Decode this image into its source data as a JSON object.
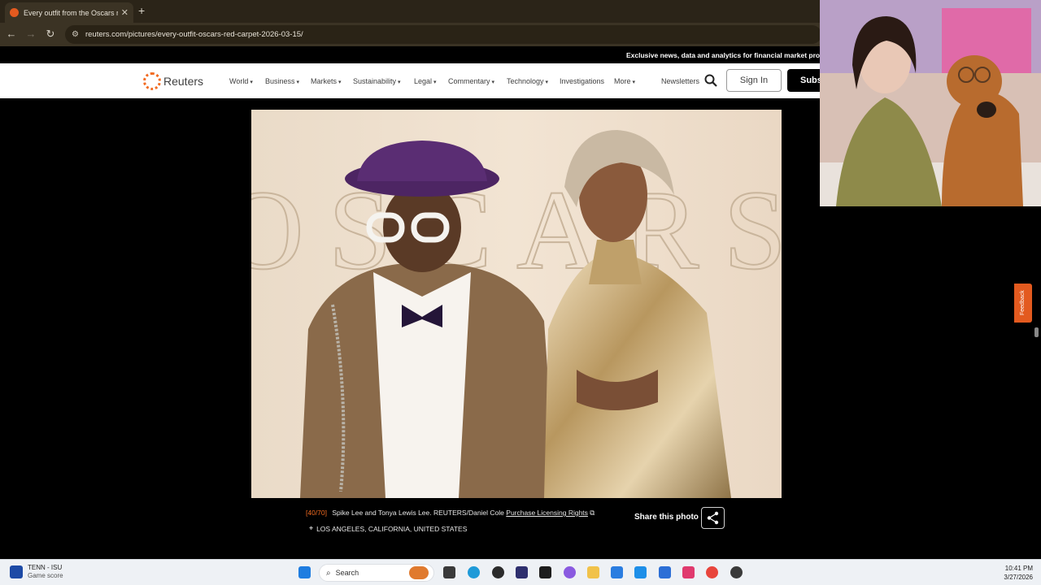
{
  "browser": {
    "tab_title": "Every outfit from the Oscars re",
    "url": "reuters.com/pictures/every-outfit-oscars-red-carpet-2026-03-15/"
  },
  "promo_banner": "Exclusive news, data and analytics for financial market prof",
  "nav": {
    "logo_text": "Reuters",
    "items": [
      {
        "label": "World",
        "has_dropdown": true
      },
      {
        "label": "Business",
        "has_dropdown": true
      },
      {
        "label": "Markets",
        "has_dropdown": true
      },
      {
        "label": "Sustainability",
        "has_dropdown": true
      },
      {
        "label": "Legal",
        "has_dropdown": true
      },
      {
        "label": "Commentary",
        "has_dropdown": true
      },
      {
        "label": "Technology",
        "has_dropdown": true
      },
      {
        "label": "Investigations",
        "has_dropdown": false
      },
      {
        "label": "More",
        "has_dropdown": true
      }
    ],
    "newsletters": "Newsletters",
    "sign_in": "Sign In",
    "subscribe": "Subs"
  },
  "gallery": {
    "counter": "[40/70]",
    "caption": "Spike Lee and Tonya Lewis Lee. REUTERS/Daniel Cole",
    "licensing_link": "Purchase Licensing Rights",
    "location": "LOS ANGELES, CALIFORNIA, UNITED STATES",
    "share_label": "Share this photo",
    "backdrop_text": "OSCARS"
  },
  "feedback_label": "Feedback",
  "taskbar": {
    "widget_title": "TENN - ISU",
    "widget_sub": "Game score",
    "search_label": "Search",
    "time": "10:41 PM",
    "date": "3/27/2026"
  },
  "colors": {
    "accent": "#f26b21",
    "page_bg": "#000000",
    "browser_chrome": "#3b3324"
  }
}
